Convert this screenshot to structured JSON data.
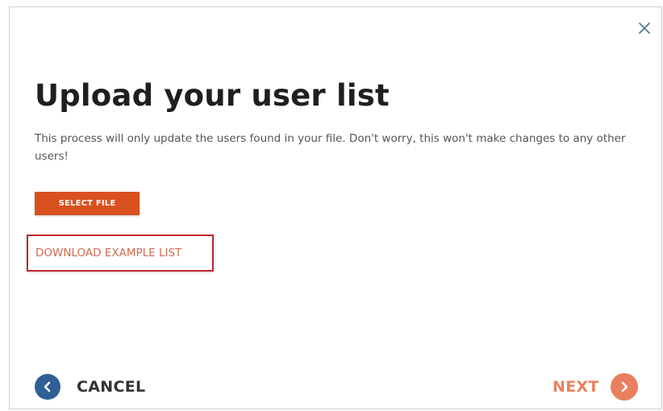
{
  "dialog": {
    "title": "Upload your user list",
    "description": "This process will only update the users found in your file. Don't worry, this won't make changes to any other users!",
    "select_file_label": "SELECT FILE",
    "download_link_label": "DOWNLOAD EXAMPLE LIST",
    "close_icon": "close-icon"
  },
  "footer": {
    "cancel_label": "CANCEL",
    "cancel_icon": "chevron-left-circle-icon",
    "next_label": "NEXT",
    "next_icon": "chevron-right-circle-icon"
  },
  "colors": {
    "accent": "#d9501f",
    "next_accent": "#e8805f",
    "cancel_accent": "#2f5f96",
    "highlight_border": "#c0282d",
    "link": "#cf6b4f"
  }
}
